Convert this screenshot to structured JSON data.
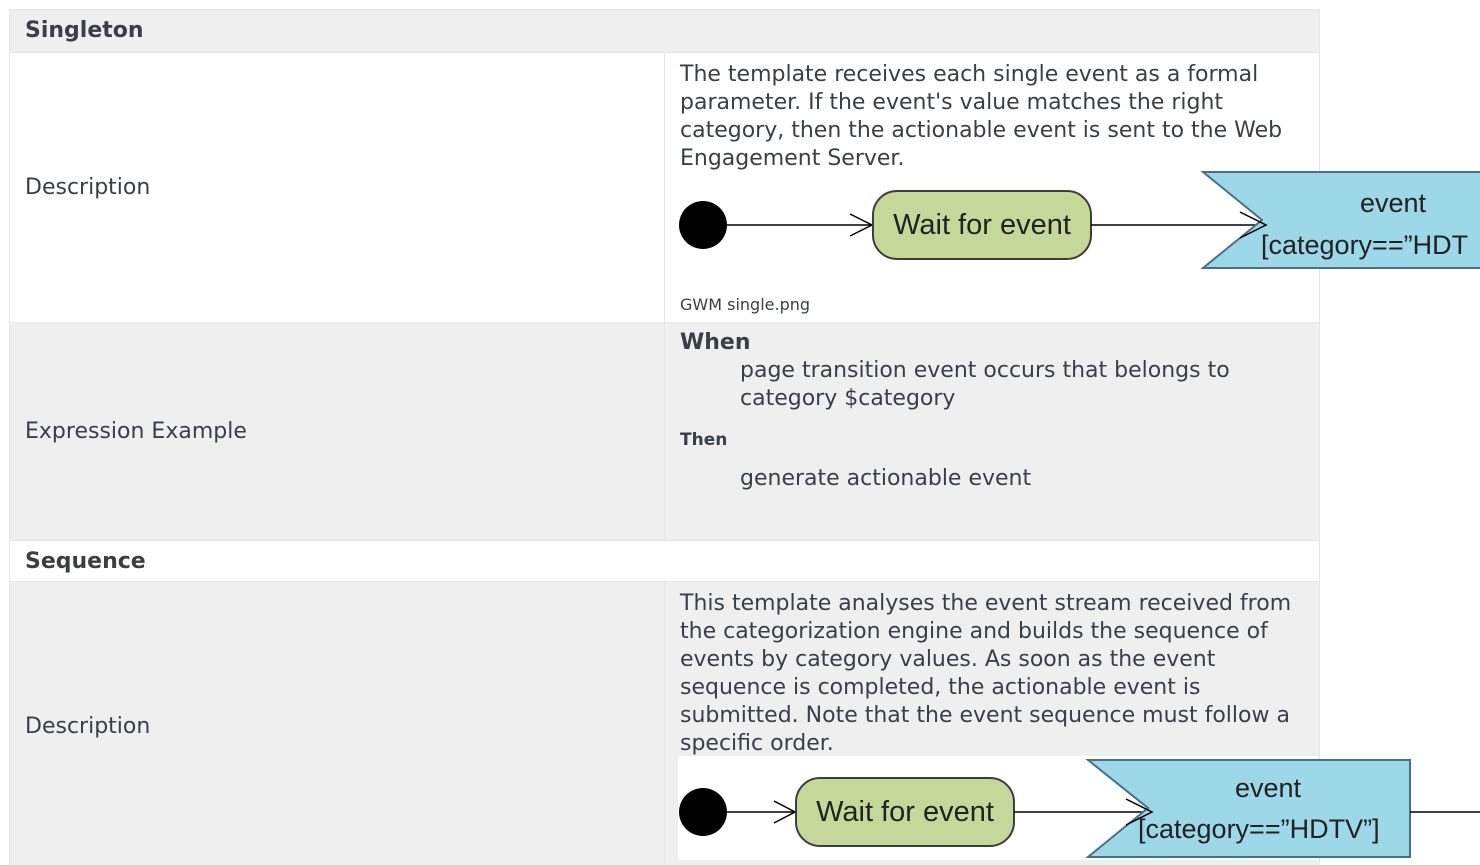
{
  "singleton": {
    "heading": "Singleton",
    "description_label": "Description",
    "description_text": "The template receives each single event as a formal parameter. If the event's value matches the right category, then the actionable event is sent to the Web Engagement Server.",
    "diagram": {
      "state_label": "Wait for event",
      "event_line1": "event",
      "event_line2": "[category==”HDT"
    },
    "image_caption": "GWM single.png",
    "expression_label": "Expression Example",
    "when_label": "When",
    "when_text": "page transition event occurs that belongs to category $category",
    "then_label": "Then",
    "then_text": "generate actionable event"
  },
  "sequence": {
    "heading": "Sequence",
    "description_label": "Description",
    "description_text": "This template analyses the event stream received from the categorization engine and builds the sequence of events by category values. As soon as the event sequence is completed, the actionable event is submitted. Note that the event sequence must follow a specific order.",
    "diagram": {
      "state_label": "Wait for event",
      "event_line1": "event",
      "event_line2": "[category==”HDTV”]"
    }
  },
  "colors": {
    "state_fill": "#c5d89a",
    "event_fill": "#9dd8e8",
    "row_grey": "#efeff0",
    "text": "#3a3f44"
  }
}
